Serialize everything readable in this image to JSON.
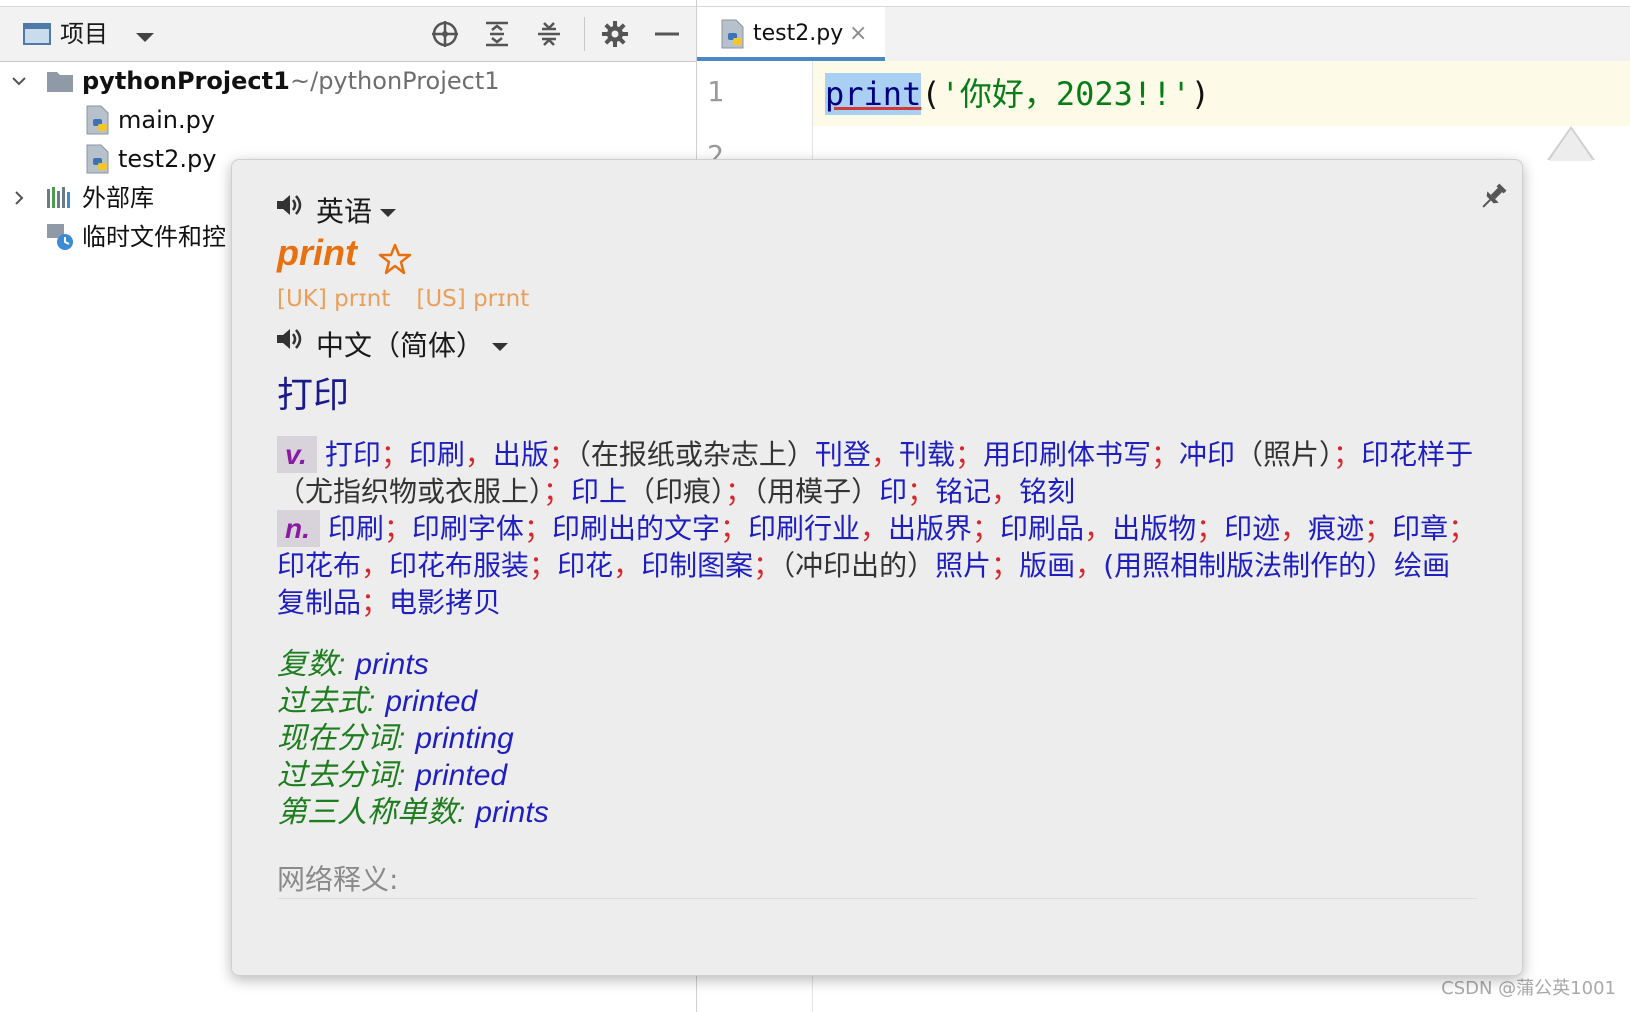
{
  "project_panel": {
    "title": "项目",
    "tree": [
      {
        "name": "pythonProject1",
        "path": "~/pythonProject1"
      },
      {
        "name": "main.py"
      },
      {
        "name": "test2.py"
      },
      {
        "name": "外部库"
      },
      {
        "name": "临时文件和控"
      }
    ],
    "toolbar_icons": [
      "target-icon",
      "expand-all-icon",
      "collapse-all-icon",
      "gear-icon",
      "minimize-icon"
    ]
  },
  "editor": {
    "tab_label": "test2.py",
    "tab_close": "×",
    "line_numbers": [
      "1",
      "2"
    ],
    "code": {
      "function": "print",
      "open": "(",
      "string": "'你好，2023!!'",
      "close": ")"
    }
  },
  "popup": {
    "source_language": "英语",
    "word": "print",
    "phonetics": [
      "[UK] prɪnt",
      "[US] prɪnt"
    ],
    "target_language": "中文（简体）",
    "translation": "打印",
    "definitions": [
      {
        "pos": "v.",
        "items": [
          {
            "t": "打印",
            "s": "；"
          },
          {
            "t": "印刷",
            "s": "，"
          },
          {
            "t": "出版",
            "s": "；"
          },
          {
            "p": "（在报纸或杂志上）"
          },
          {
            "t": "刊登",
            "s": "，"
          },
          {
            "t": "刊载",
            "s": "；"
          },
          {
            "t": "用印刷体书写",
            "s": "；"
          },
          {
            "t": "冲印",
            "p2": "（照片）",
            "s": "；"
          },
          {
            "t": "印花样于",
            "p2": "（尤指织物或衣服上）",
            "s": "；"
          },
          {
            "t": "印上",
            "p2": "（印痕）",
            "s": "；"
          },
          {
            "p": "（用模子）"
          },
          {
            "t": "印",
            "s": "；"
          },
          {
            "t": "铭记",
            "s": "，"
          },
          {
            "t": "铭刻",
            "s": ""
          }
        ]
      },
      {
        "pos": "n.",
        "items": [
          {
            "t": "印刷",
            "s": "；"
          },
          {
            "t": "印刷字体",
            "s": "；"
          },
          {
            "t": "印刷出的文字",
            "s": "；"
          },
          {
            "t": "印刷行业",
            "s": "，"
          },
          {
            "t": "出版界",
            "s": "；"
          },
          {
            "t": "印刷品",
            "s": "，"
          },
          {
            "t": "出版物",
            "s": "；"
          },
          {
            "t": "印迹",
            "s": "，"
          },
          {
            "t": "痕迹",
            "s": "；"
          },
          {
            "t": "印章",
            "s": "；"
          },
          {
            "t": "印花布",
            "s": "，"
          },
          {
            "t": "印花布服装",
            "s": "；"
          },
          {
            "t": "印花",
            "s": "，"
          },
          {
            "t": "印制图案",
            "s": "；"
          },
          {
            "p": "（冲印出的）"
          },
          {
            "t": "照片",
            "s": "；"
          },
          {
            "t": "版画",
            "s": "，"
          },
          {
            "t": "(用照相制版法制作的）绘画复制品",
            "s": "；"
          },
          {
            "t": "电影拷贝",
            "s": ""
          }
        ]
      }
    ],
    "forms": [
      {
        "label": "复数:",
        "value": "prints"
      },
      {
        "label": "过去式:",
        "value": "printed"
      },
      {
        "label": "现在分词:",
        "value": "printing"
      },
      {
        "label": "过去分词:",
        "value": "printed"
      },
      {
        "label": "第三人称单数:",
        "value": "prints"
      }
    ],
    "web_label": "网络释义:"
  },
  "watermark": "CSDN @蒲公英1001",
  "colors": {
    "accent_blue": "#4a88c7",
    "word_orange": "#e8700f",
    "definition_blue": "#1f1fbf",
    "separator_red": "#d8262d",
    "pos_purple": "#8a1aa3",
    "form_green": "#1e7d1e",
    "string_green": "#067d17"
  }
}
